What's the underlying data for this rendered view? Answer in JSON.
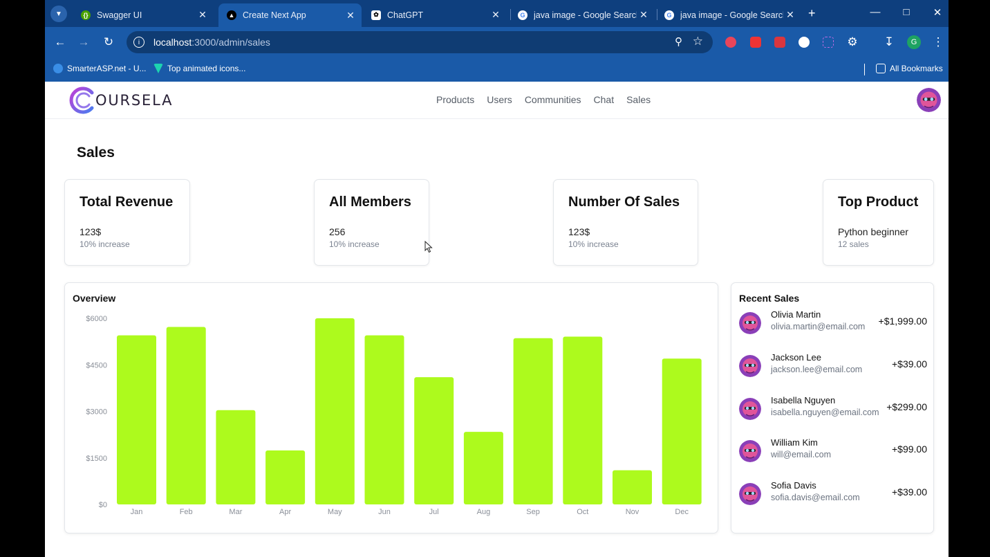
{
  "browser": {
    "tabs": [
      {
        "title": "Swagger UI",
        "icon": "swagger-icon",
        "color": "#85ea2d"
      },
      {
        "title": "Create Next App",
        "icon": "nextjs-icon",
        "color": "#000000",
        "active": true
      },
      {
        "title": "ChatGPT",
        "icon": "chatgpt-icon",
        "color": "#ffffff"
      },
      {
        "title": "java image - Google Search",
        "icon": "google-icon",
        "color": "#ffffff"
      },
      {
        "title": "java image - Google Search",
        "icon": "google-icon",
        "color": "#ffffff"
      }
    ],
    "url_host": "localhost",
    "url_path": ":3000/admin/sales",
    "bookmarks": [
      {
        "label": "SmarterASP.net - U...",
        "icon": "smarterasp-icon"
      },
      {
        "label": "Top animated icons...",
        "icon": "vuetify-icon"
      }
    ],
    "all_bookmarks": "All Bookmarks",
    "profile_initial": "G"
  },
  "app": {
    "logo_text": "OURSELA",
    "nav": [
      "Products",
      "Users",
      "Communities",
      "Chat",
      "Sales"
    ],
    "page_title": "Sales",
    "accent": "#adfa1d"
  },
  "stats": [
    {
      "title": "Total Revenue",
      "value": "123$",
      "sub": "10% increase"
    },
    {
      "title": "All Members",
      "value": "256",
      "sub": "10% increase"
    },
    {
      "title": "Number Of Sales",
      "value": "123$",
      "sub": "10% increase"
    },
    {
      "title": "Top Product",
      "value": "Python beginner",
      "sub": "12 sales"
    }
  ],
  "overview": {
    "title": "Overview"
  },
  "chart_data": {
    "type": "bar",
    "categories": [
      "Jan",
      "Feb",
      "Mar",
      "Apr",
      "May",
      "Jun",
      "Jul",
      "Aug",
      "Sep",
      "Oct",
      "Nov",
      "Dec"
    ],
    "values": [
      5450,
      5720,
      3040,
      1740,
      6000,
      5450,
      4100,
      2340,
      5360,
      5410,
      1100,
      4700
    ],
    "ytick_labels": [
      "$0",
      "$1500",
      "$3000",
      "$4500",
      "$6000"
    ],
    "yticks": [
      0,
      1500,
      3000,
      4500,
      6000
    ],
    "ylim": [
      0,
      6000
    ],
    "grid": false,
    "color": "#adfa1d"
  },
  "recent_sales": {
    "title": "Recent Sales",
    "items": [
      {
        "name": "Olivia Martin",
        "email": "olivia.martin@email.com",
        "amount": "+$1,999.00"
      },
      {
        "name": "Jackson Lee",
        "email": "jackson.lee@email.com",
        "amount": "+$39.00"
      },
      {
        "name": "Isabella Nguyen",
        "email": "isabella.nguyen@email.com",
        "amount": "+$299.00"
      },
      {
        "name": "William Kim",
        "email": "will@email.com",
        "amount": "+$99.00"
      },
      {
        "name": "Sofia Davis",
        "email": "sofia.davis@email.com",
        "amount": "+$39.00"
      }
    ]
  }
}
